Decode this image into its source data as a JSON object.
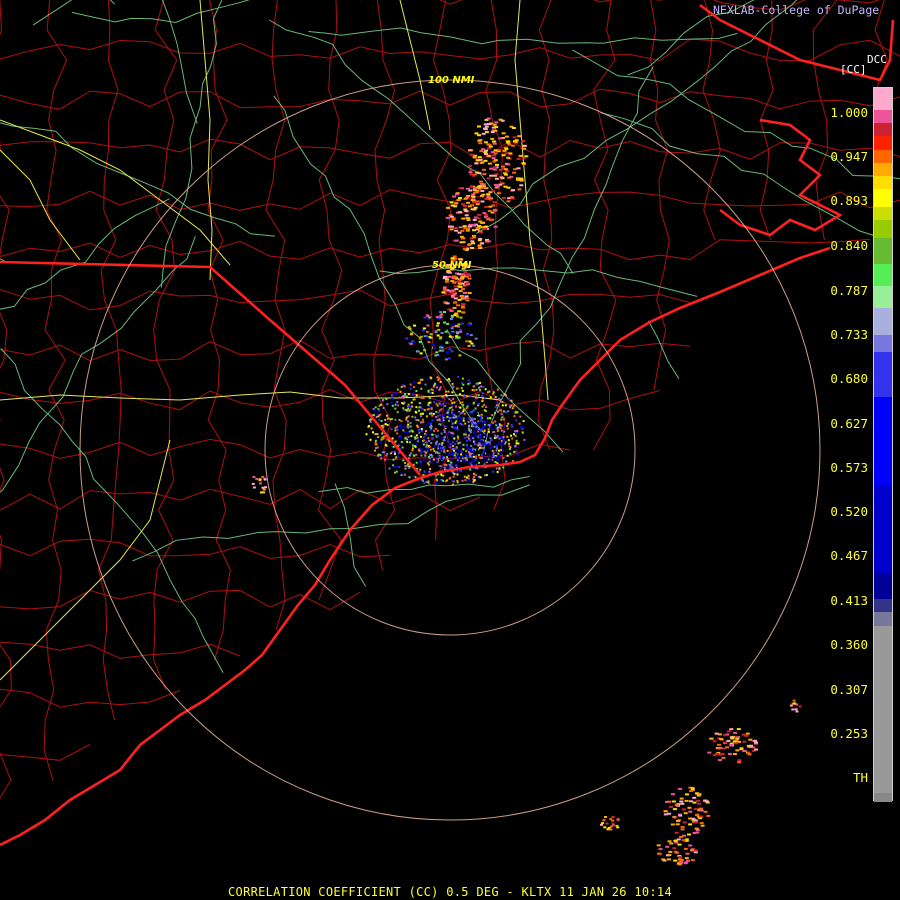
{
  "header": {
    "credit": "NEXLAB-College of DuPage",
    "product_code": "DCC",
    "unit": "[CC]"
  },
  "footer": {
    "caption": "CORRELATION COEFFICIENT (CC) 0.5 DEG - KLTX 11 JAN 26 10:14"
  },
  "range_rings": {
    "labels": [
      "100 NMI",
      "50 NMI"
    ]
  },
  "colorbar": {
    "ticks": [
      "1.000",
      "0.947",
      "0.893",
      "0.840",
      "0.787",
      "0.733",
      "0.680",
      "0.627",
      "0.573",
      "0.520",
      "0.467",
      "0.413",
      "0.360",
      "0.307",
      "0.253",
      "TH"
    ],
    "segments": [
      {
        "from": 1.0,
        "color": "#ffaacc"
      },
      {
        "from": 0.975,
        "color": "#ee5599"
      },
      {
        "from": 0.96,
        "color": "#cc2233"
      },
      {
        "from": 0.945,
        "color": "#ff2200"
      },
      {
        "from": 0.93,
        "color": "#ff6600"
      },
      {
        "from": 0.915,
        "color": "#ffaa00"
      },
      {
        "from": 0.9,
        "color": "#ffdd00"
      },
      {
        "from": 0.885,
        "color": "#ffff00"
      },
      {
        "from": 0.865,
        "color": "#ccdd00"
      },
      {
        "from": 0.85,
        "color": "#99cc00"
      },
      {
        "from": 0.83,
        "color": "#66bb33"
      },
      {
        "from": 0.8,
        "color": "#55ee55"
      },
      {
        "from": 0.775,
        "color": "#99ee99"
      },
      {
        "from": 0.75,
        "color": "#aab0dd"
      },
      {
        "from": 0.72,
        "color": "#7777dd"
      },
      {
        "from": 0.7,
        "color": "#3333ee"
      },
      {
        "from": 0.65,
        "color": "#0000ff"
      },
      {
        "from": 0.55,
        "color": "#0000cc"
      },
      {
        "from": 0.45,
        "color": "#000099"
      },
      {
        "from": 0.42,
        "color": "#333388"
      },
      {
        "from": 0.405,
        "color": "#777799"
      },
      {
        "from": 0.39,
        "color": "#999999"
      },
      {
        "from": 0.2,
        "color": "#888888"
      },
      {
        "from": 0.19,
        "color": "#000000"
      }
    ]
  },
  "colors": {
    "state_border": "#ff2020",
    "county_line": "#b01010",
    "highway": "#7cd88c",
    "interstate": "#e8e850",
    "range_ring": "#f0b8a0",
    "label_text": "#ffff33",
    "credit_text": "#c8b4ff"
  }
}
